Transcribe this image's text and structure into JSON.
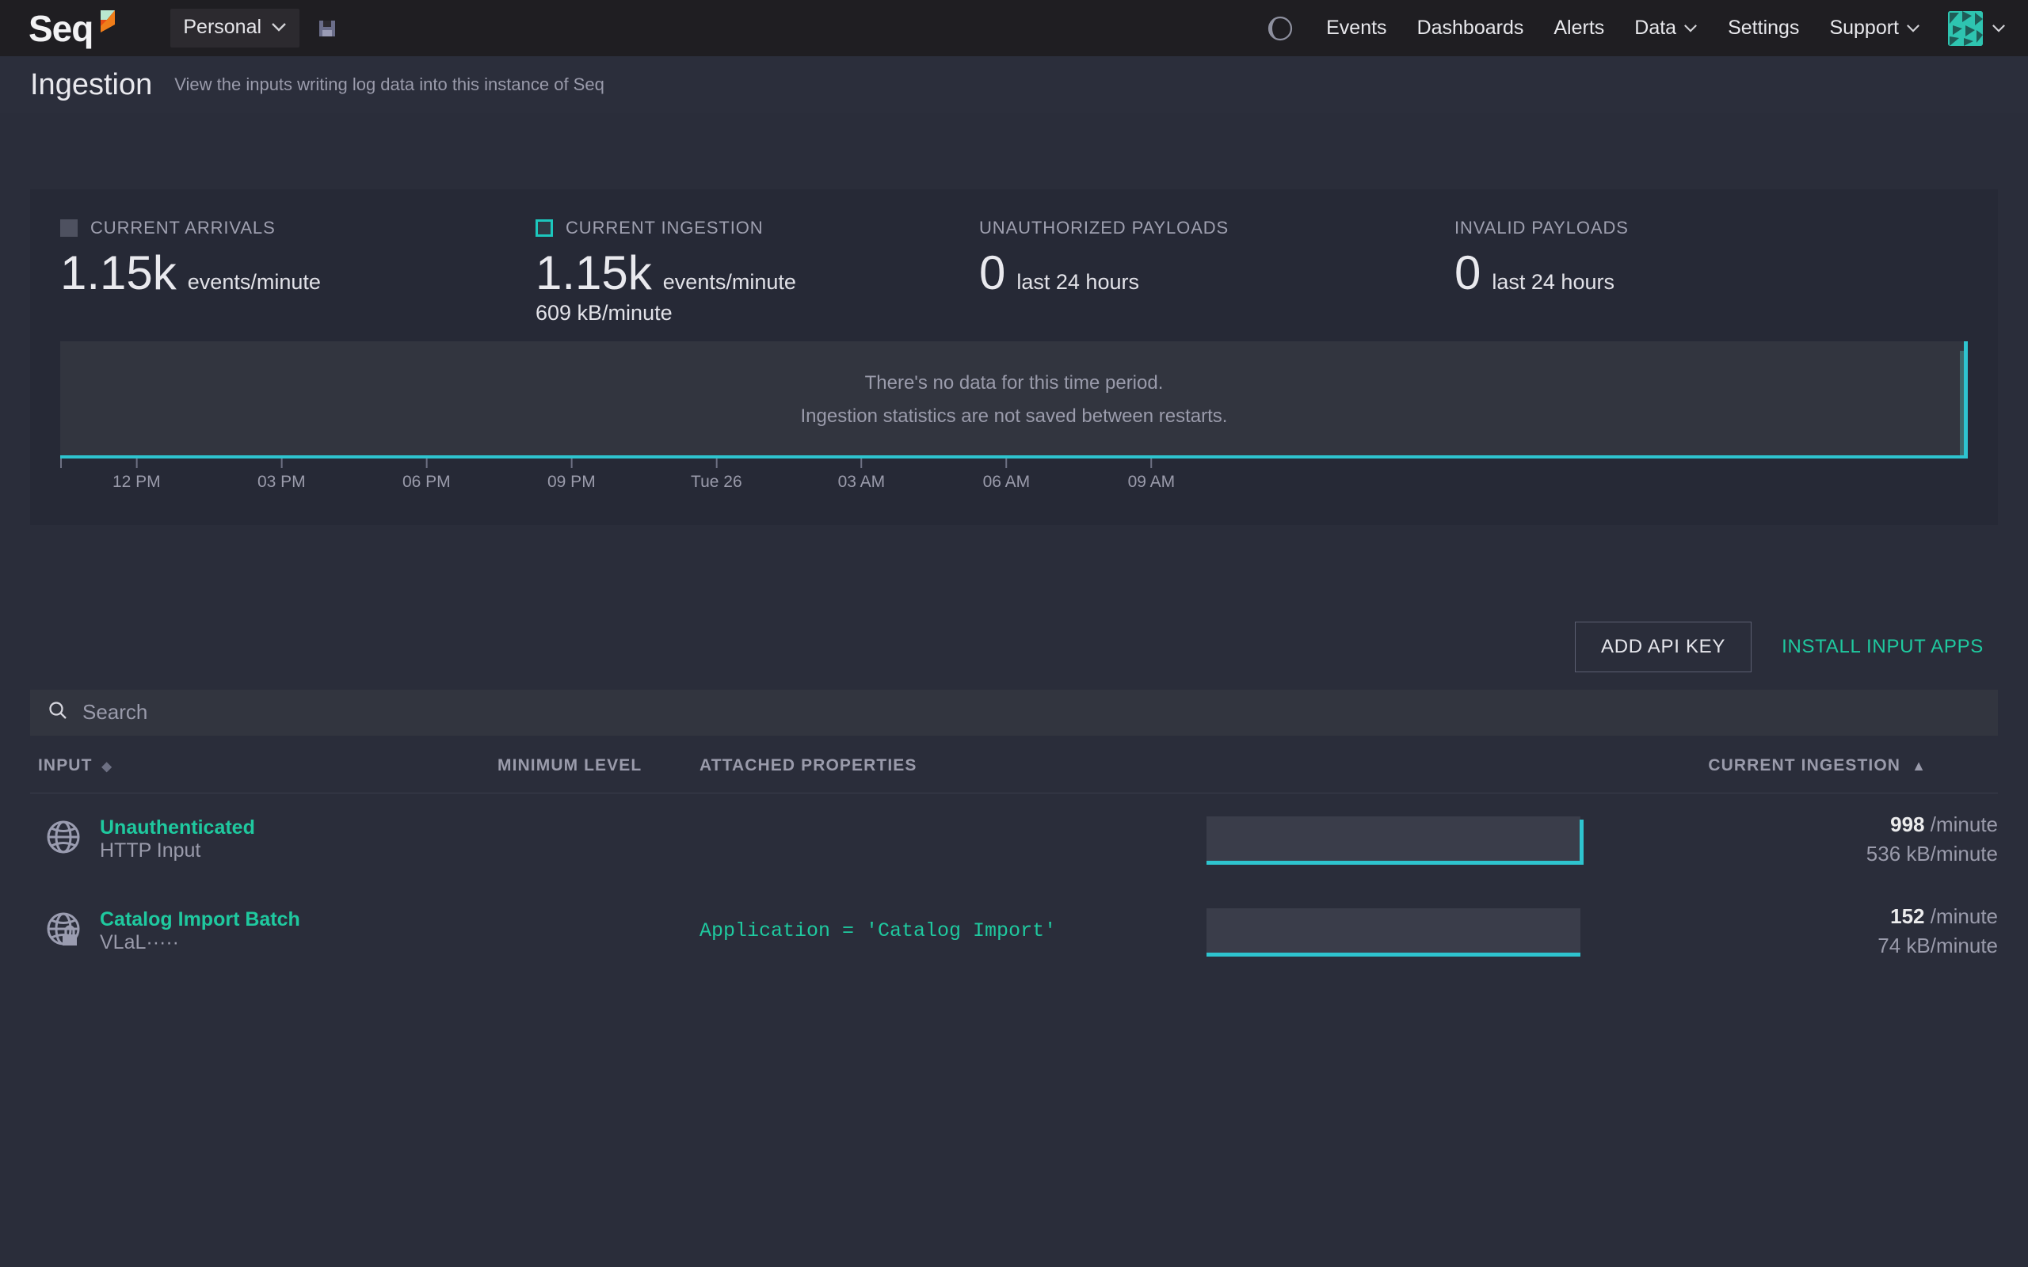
{
  "topbar": {
    "logo_text": "Seq",
    "logo_icon": "seq-flag-logo",
    "scope_label": "Personal",
    "scope_caret": "⌄",
    "save_icon": "save-floppy-icon",
    "theme_toggle_icon": "moon-icon",
    "nav_items": [
      {
        "label": "Events",
        "has_caret": false
      },
      {
        "label": "Dashboards",
        "has_caret": false
      },
      {
        "label": "Alerts",
        "has_caret": false
      },
      {
        "label": "Data",
        "has_caret": true
      },
      {
        "label": "Settings",
        "has_caret": false
      },
      {
        "label": "Support",
        "has_caret": true
      }
    ],
    "avatar_caret": "⌄"
  },
  "page": {
    "title": "Ingestion",
    "subtitle": "View the inputs writing log data into this instance of Seq"
  },
  "stats": [
    {
      "label": "CURRENT ARRIVALS",
      "swatch": "grey",
      "value": "1.15k",
      "unit": "events/minute",
      "sub": ""
    },
    {
      "label": "CURRENT INGESTION",
      "swatch": "teal",
      "value": "1.15k",
      "unit": "events/minute",
      "sub": "609 kB/minute"
    },
    {
      "label": "UNAUTHORIZED PAYLOADS",
      "swatch": "none",
      "value": "0",
      "unit": "last 24 hours",
      "sub": ""
    },
    {
      "label": "INVALID PAYLOADS",
      "swatch": "none",
      "value": "0",
      "unit": "last 24 hours",
      "sub": ""
    }
  ],
  "chart_data": {
    "type": "area",
    "title": "",
    "xlabel": "",
    "ylabel": "",
    "empty_message_line1": "There's no data for this time period.",
    "empty_message_line2": "Ingestion statistics are not saved between restarts.",
    "grid": false,
    "legend": "none",
    "series": [
      {
        "name": "Current ingestion",
        "color": "#2ec4cf",
        "values": [
          0,
          0,
          0,
          0,
          0,
          0,
          0,
          0,
          0,
          1.0
        ]
      },
      {
        "name": "Current arrivals",
        "color": "#3d6a6d",
        "values": [
          0,
          0,
          0,
          0,
          0,
          0,
          0,
          0,
          0,
          0.92
        ]
      }
    ],
    "x": [
      "12 PM",
      "03 PM",
      "06 PM",
      "09 PM",
      "Tue 26",
      "03 AM",
      "06 AM",
      "09 AM"
    ],
    "tick_labels": [
      "12 PM",
      "03 PM",
      "06 PM",
      "09 PM",
      "Tue 26",
      "03 AM",
      "06 AM",
      "09 AM"
    ],
    "tick_positions_pct": [
      4.0,
      11.6,
      19.2,
      26.8,
      34.4,
      42.0,
      49.6,
      57.2
    ],
    "ylim": [
      0,
      1
    ]
  },
  "actions": {
    "add_api_key": "ADD API KEY",
    "install_input_apps": "INSTALL INPUT APPS"
  },
  "search": {
    "placeholder": "Search",
    "value": "",
    "icon": "search-icon"
  },
  "table": {
    "columns": [
      {
        "key": "input",
        "label": "INPUT",
        "sort_indicator": "◆"
      },
      {
        "key": "level",
        "label": "MINIMUM LEVEL",
        "sort_indicator": ""
      },
      {
        "key": "props",
        "label": "ATTACHED PROPERTIES",
        "sort_indicator": ""
      },
      {
        "key": "spark",
        "label": "",
        "sort_indicator": ""
      },
      {
        "key": "rate",
        "label": "CURRENT INGESTION",
        "sort_indicator": "▲"
      }
    ],
    "rows": [
      {
        "icon": "globe-icon",
        "name": "Unauthenticated",
        "meta": "HTTP Input",
        "minimum_level": "",
        "attached_properties": "",
        "rate_value": "998",
        "rate_unit": "/minute",
        "rate_sub": "536 kB/minute",
        "spark_spike": true
      },
      {
        "icon": "globe-lock-icon",
        "name": "Catalog Import Batch",
        "meta": "VLaL·····",
        "minimum_level": "",
        "attached_properties": "Application = 'Catalog Import'",
        "rate_value": "152",
        "rate_unit": "/minute",
        "rate_sub": "74 kB/minute",
        "spark_spike": false
      }
    ]
  },
  "colors": {
    "accent_green": "#1fc99f",
    "accent_teal": "#2ec4cf",
    "panel_bg": "#262936",
    "page_bg": "#2a2d3a",
    "topbar_bg": "#1f1e22",
    "muted_text": "#9a9bab"
  }
}
